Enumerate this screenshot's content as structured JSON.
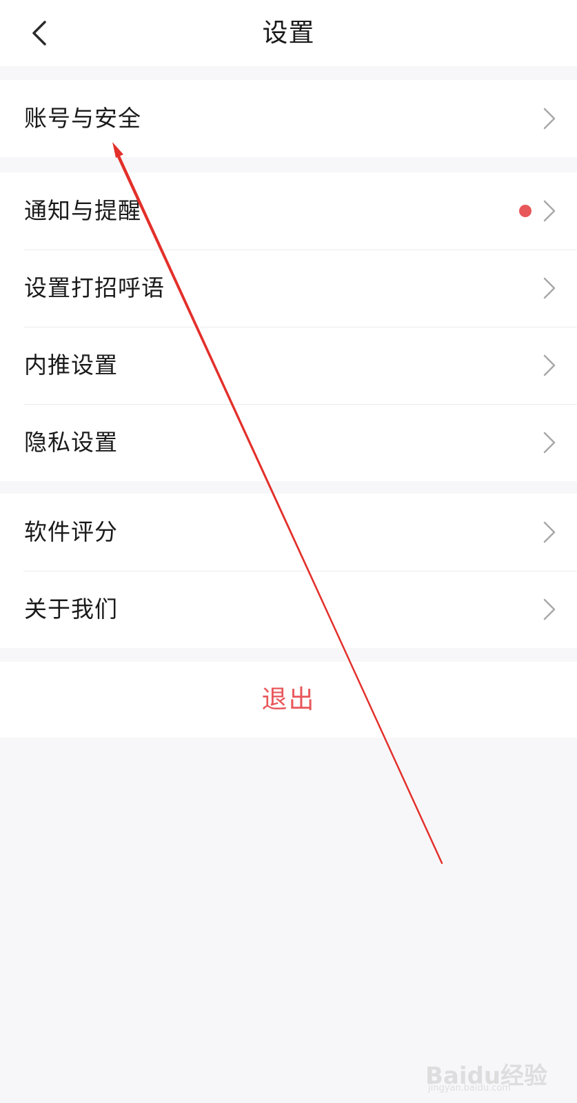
{
  "header": {
    "title": "设置",
    "back_icon": "chevron-left-icon"
  },
  "groups": [
    {
      "items": [
        {
          "label": "账号与安全",
          "badge": false
        }
      ]
    },
    {
      "items": [
        {
          "label": "通知与提醒",
          "badge": true
        },
        {
          "label": "设置打招呼语",
          "badge": false
        },
        {
          "label": "内推设置",
          "badge": false
        },
        {
          "label": "隐私设置",
          "badge": false
        }
      ]
    },
    {
      "items": [
        {
          "label": "软件评分",
          "badge": false
        },
        {
          "label": "关于我们",
          "badge": false
        }
      ]
    }
  ],
  "logout": {
    "label": "退出"
  },
  "colors": {
    "accent_red": "#e8575a",
    "page_bg": "#f7f7f9",
    "annotation_arrow": "#e3302b"
  },
  "watermark": {
    "brand": "Baidu经验",
    "url": "jingyan.baidu.com"
  }
}
